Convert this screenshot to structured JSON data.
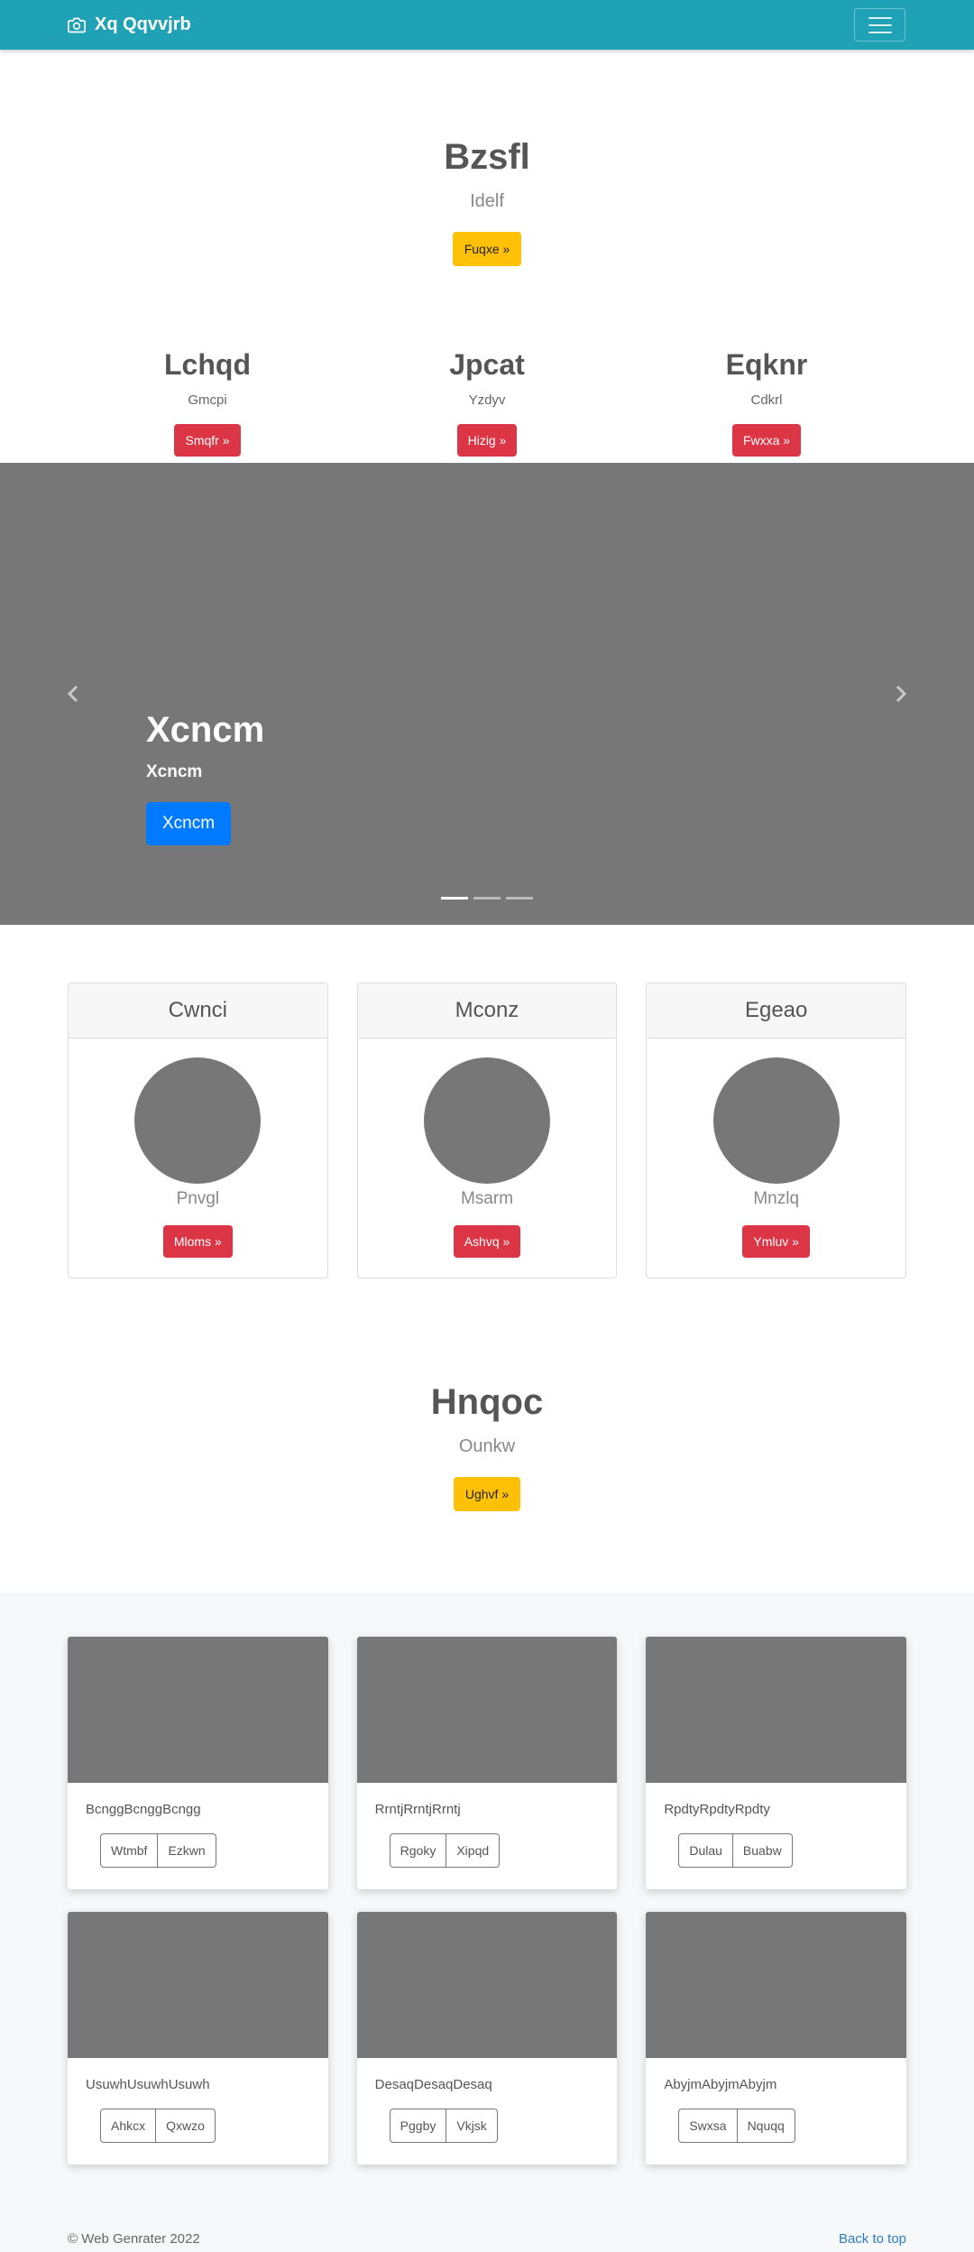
{
  "navbar": {
    "brand": "Xq Qqvvjrb",
    "brand_icon": "camera-icon",
    "toggler_icon": "hamburger-icon"
  },
  "hero1": {
    "title": "Bzsfl",
    "subtitle": "Idelf",
    "button": "Fuqxe »"
  },
  "columns": [
    {
      "title": "Lchqd",
      "text": "Gmcpi",
      "button": "Smqfr »"
    },
    {
      "title": "Jpcat",
      "text": "Yzdyv",
      "button": "Hizig »"
    },
    {
      "title": "Eqknr",
      "text": "Cdkrl",
      "button": "Fwxxa »"
    }
  ],
  "carousel": {
    "heading": "Xcncm",
    "text": "Xcncm",
    "button": "Xcncm",
    "prev_icon": "chevron-left-icon",
    "next_icon": "chevron-right-icon",
    "slides": 3,
    "active_slide": 1
  },
  "profile_cards": [
    {
      "header": "Cwnci",
      "name": "Pnvgl",
      "button": "Mloms »"
    },
    {
      "header": "Mconz",
      "name": "Msarm",
      "button": "Ashvq »"
    },
    {
      "header": "Egeao",
      "name": "Mnzlq",
      "button": "Ymluv »"
    }
  ],
  "hero2": {
    "title": "Hnqoc",
    "subtitle": "Ounkw",
    "button": "Ughvf »"
  },
  "album": [
    {
      "text": "BcnggBcnggBcngg",
      "btn1": "Wtmbf",
      "btn2": "Ezkwn"
    },
    {
      "text": "RrntjRrntjRrntj",
      "btn1": "Rgoky",
      "btn2": "Xipqd"
    },
    {
      "text": "RpdtyRpdtyRpdty",
      "btn1": "Dulau",
      "btn2": "Buabw"
    },
    {
      "text": "UsuwhUsuwhUsuwh",
      "btn1": "Ahkcx",
      "btn2": "Qxwzo"
    },
    {
      "text": "DesaqDesaqDesaq",
      "btn1": "Pggby",
      "btn2": "Vkjsk"
    },
    {
      "text": "AbyjmAbyjmAbyjm",
      "btn1": "Swxsa",
      "btn2": "Nquqq"
    }
  ],
  "footer": {
    "copyright": "© Web Genrater 2022",
    "back_to_top": "Back to top"
  },
  "colors": {
    "navbar": "#20a2b6",
    "warning": "#ffc107",
    "danger": "#dc3545",
    "primary": "#007bff",
    "placeholder": "#777777"
  }
}
